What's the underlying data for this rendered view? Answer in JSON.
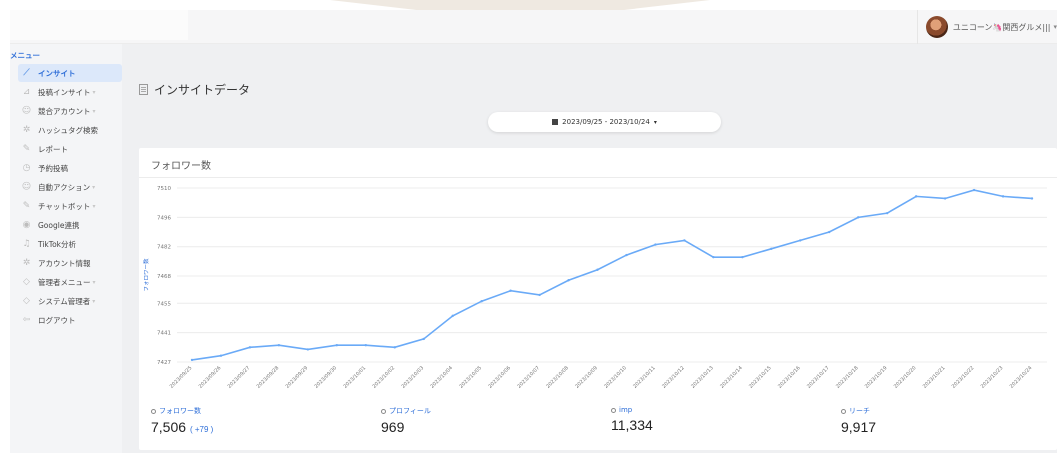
{
  "header": {
    "user_name": "ユニコーン🦄関西グルメ|||",
    "user_chevron": "▾"
  },
  "sidebar": {
    "title": "メニュー",
    "items": [
      {
        "label": "インサイト",
        "icon": "chart-line-icon",
        "active": true,
        "chevron": false
      },
      {
        "label": "投稿インサイト",
        "icon": "chart-icon",
        "active": false,
        "chevron": true
      },
      {
        "label": "競合アカウント",
        "icon": "users-icon",
        "active": false,
        "chevron": true
      },
      {
        "label": "ハッシュタグ検索",
        "icon": "gear-icon",
        "active": false,
        "chevron": false
      },
      {
        "label": "レポート",
        "icon": "edit-icon",
        "active": false,
        "chevron": false
      },
      {
        "label": "予約投稿",
        "icon": "clock-icon",
        "active": false,
        "chevron": false
      },
      {
        "label": "自動アクション",
        "icon": "users-icon",
        "active": false,
        "chevron": true
      },
      {
        "label": "チャットボット",
        "icon": "edit-icon",
        "active": false,
        "chevron": true
      },
      {
        "label": "Google連携",
        "icon": "location-icon",
        "active": false,
        "chevron": false
      },
      {
        "label": "TikTok分析",
        "icon": "music-icon",
        "active": false,
        "chevron": false
      },
      {
        "label": "アカウント情報",
        "icon": "gear-icon",
        "active": false,
        "chevron": false
      },
      {
        "label": "管理者メニュー",
        "icon": "diamond-icon",
        "active": false,
        "chevron": true
      },
      {
        "label": "システム管理者",
        "icon": "diamond-icon",
        "active": false,
        "chevron": true
      },
      {
        "label": "ログアウト",
        "icon": "logout-icon",
        "active": false,
        "chevron": false
      }
    ]
  },
  "main": {
    "page_title": "インサイトデータ",
    "date_range": "2023/09/25 - 2023/10/24",
    "card_title": "フォロワー数",
    "stats": [
      {
        "label": "フォロワー数",
        "value": "7,506",
        "delta": "( +79 )"
      },
      {
        "label": "プロフィール",
        "value": "969",
        "delta": ""
      },
      {
        "label": "imp",
        "value": "11,334",
        "delta": ""
      },
      {
        "label": "リーチ",
        "value": "9,917",
        "delta": ""
      }
    ]
  },
  "colors": {
    "accent": "#2f6fd8",
    "line": "#6aaaf7",
    "sidebar_active_bg": "#dce8fa"
  },
  "chart_data": {
    "type": "line",
    "ylabel": "フォロワー数",
    "ylim": [
      7427,
      7510
    ],
    "yticks": [
      7427,
      7441,
      7455,
      7468,
      7482,
      7496,
      7510
    ],
    "categories": [
      "2023/09/25",
      "2023/09/26",
      "2023/09/27",
      "2023/09/28",
      "2023/09/29",
      "2023/09/30",
      "2023/10/01",
      "2023/10/02",
      "2023/10/03",
      "2023/10/04",
      "2023/10/05",
      "2023/10/06",
      "2023/10/07",
      "2023/10/08",
      "2023/10/09",
      "2023/10/10",
      "2023/10/11",
      "2023/10/12",
      "2023/10/13",
      "2023/10/14",
      "2023/10/15",
      "2023/10/16",
      "2023/10/17",
      "2023/10/18",
      "2023/10/19",
      "2023/10/20",
      "2023/10/21",
      "2023/10/22",
      "2023/10/23",
      "2023/10/24"
    ],
    "series": [
      {
        "values": [
          7428,
          7430,
          7434,
          7435,
          7433,
          7435,
          7435,
          7434,
          7438,
          7449,
          7456,
          7461,
          7459,
          7466,
          7471,
          7478,
          7483,
          7485,
          7477,
          7477,
          7481,
          7485,
          7489,
          7496,
          7498,
          7506,
          7505,
          7509,
          7506,
          7505
        ]
      }
    ],
    "grid": true,
    "legend": "none"
  }
}
